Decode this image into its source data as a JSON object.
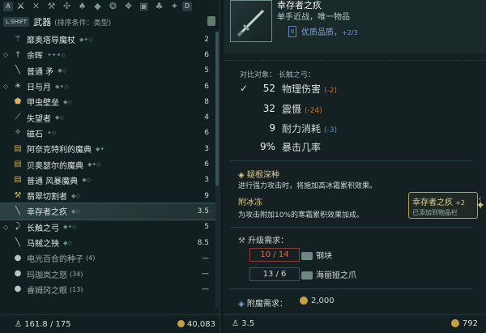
{
  "tabs": {
    "left_key": "A",
    "right_key": "D",
    "icons": [
      "swords-icon",
      "sword-icon",
      "axe-icon",
      "crossbow-icon",
      "flask-icon",
      "gem-icon",
      "ring-icon",
      "necklace-icon",
      "box-icon"
    ]
  },
  "header": {
    "shift_key": "L.SHIFT",
    "title": "武器",
    "sort_label": "(排序条件：类型)"
  },
  "items": [
    {
      "name": "靡奥塔导魔杖",
      "value": "2",
      "marker": "",
      "icon": "staff-icon"
    },
    {
      "name": "余晖",
      "value": "6",
      "marker": "◇",
      "icon": "sword-icon"
    },
    {
      "name": "普通 矛",
      "value": "5",
      "marker": "",
      "icon": "spear-icon"
    },
    {
      "name": "日与月",
      "value": "6",
      "marker": "◇",
      "icon": "sun-moon-icon"
    },
    {
      "name": "甲虫壁垒",
      "value": "8",
      "marker": "",
      "icon": "shield-icon"
    },
    {
      "name": "失望者",
      "value": "4",
      "marker": "",
      "icon": "blade-icon"
    },
    {
      "name": "磁石",
      "value": "6",
      "marker": "",
      "icon": "mace-icon"
    },
    {
      "name": "阿奈克特利的魔典",
      "value": "3",
      "marker": "",
      "icon": "tome-icon"
    },
    {
      "name": "贝奥瑟尔的魔典",
      "value": "6",
      "marker": "",
      "icon": "tome-icon"
    },
    {
      "name": "普通 风暴魔典",
      "value": "3",
      "marker": "",
      "icon": "tome-icon"
    },
    {
      "name": "翡翠切割者",
      "value": "9",
      "marker": "",
      "icon": "axe-icon"
    },
    {
      "name": "幸存者之疚",
      "value": "3.5",
      "marker": "",
      "icon": "sword-icon",
      "selected": true
    },
    {
      "name": "长触之弓",
      "value": "5",
      "marker": "◇",
      "icon": "bow-icon"
    },
    {
      "name": "马贼之殃",
      "value": "8.5",
      "marker": "",
      "icon": "polearm-icon"
    },
    {
      "name": "电光百合的种子",
      "count": "(4)",
      "value": "—",
      "marker": "",
      "icon": "seed-icon",
      "muted": true
    },
    {
      "name": "玛珈岚之怒",
      "count": "(34)",
      "value": "—",
      "marker": "",
      "icon": "seed-icon",
      "muted": true
    },
    {
      "name": "睿姆冈之眼",
      "count": "(13)",
      "value": "—",
      "marker": "",
      "icon": "seed-icon",
      "muted": true
    }
  ],
  "left_footer": {
    "weight": "161.8 / 175",
    "gold": "40,083"
  },
  "detail": {
    "name": "幸存者之疚",
    "subtitle": "单手近战，唯一物品",
    "quality_key": "II",
    "quality": "优质品质，",
    "quality_extra": "+2/3",
    "compare": "对比对象：   长触之弓：",
    "stats": [
      {
        "value": "52",
        "label": "物理伤害",
        "delta": "(-2)",
        "delta_color": "orange"
      },
      {
        "value": "32",
        "label": "震慑",
        "delta": "(-24)",
        "delta_color": "orange"
      },
      {
        "value": "9",
        "label": "耐力消耗",
        "delta": "(-3)",
        "delta_color": "blue"
      },
      {
        "value": "9%",
        "label": "暴击几率",
        "delta": "",
        "delta_color": "none"
      }
    ],
    "trait1_title": "疑根深种",
    "trait1_desc": "进行强力攻击时，将施加高冰霜累积效果。",
    "trait2_title": "附冰冻",
    "trait2_desc": "为攻击附加10%的寒霜累积效果加成。",
    "upgrade_title": "升级需求：",
    "materials": [
      {
        "qty": "10 / 14",
        "name": "钢块",
        "insufficient": true
      },
      {
        "qty": "13 / 6",
        "name": "海丽娅之爪",
        "insufficient": false
      }
    ],
    "enchant_title": "附魔需求：",
    "enchant_cost": "2,000",
    "footer_weight": "3.5",
    "footer_gold": "792"
  },
  "tooltip": {
    "title": "幸存者之疚",
    "level": "+2",
    "note": "已添加到物品栏"
  },
  "colors": {
    "accent": "#e0c78a",
    "quality": "#7fa5d8",
    "negative": "#c86f2e"
  }
}
